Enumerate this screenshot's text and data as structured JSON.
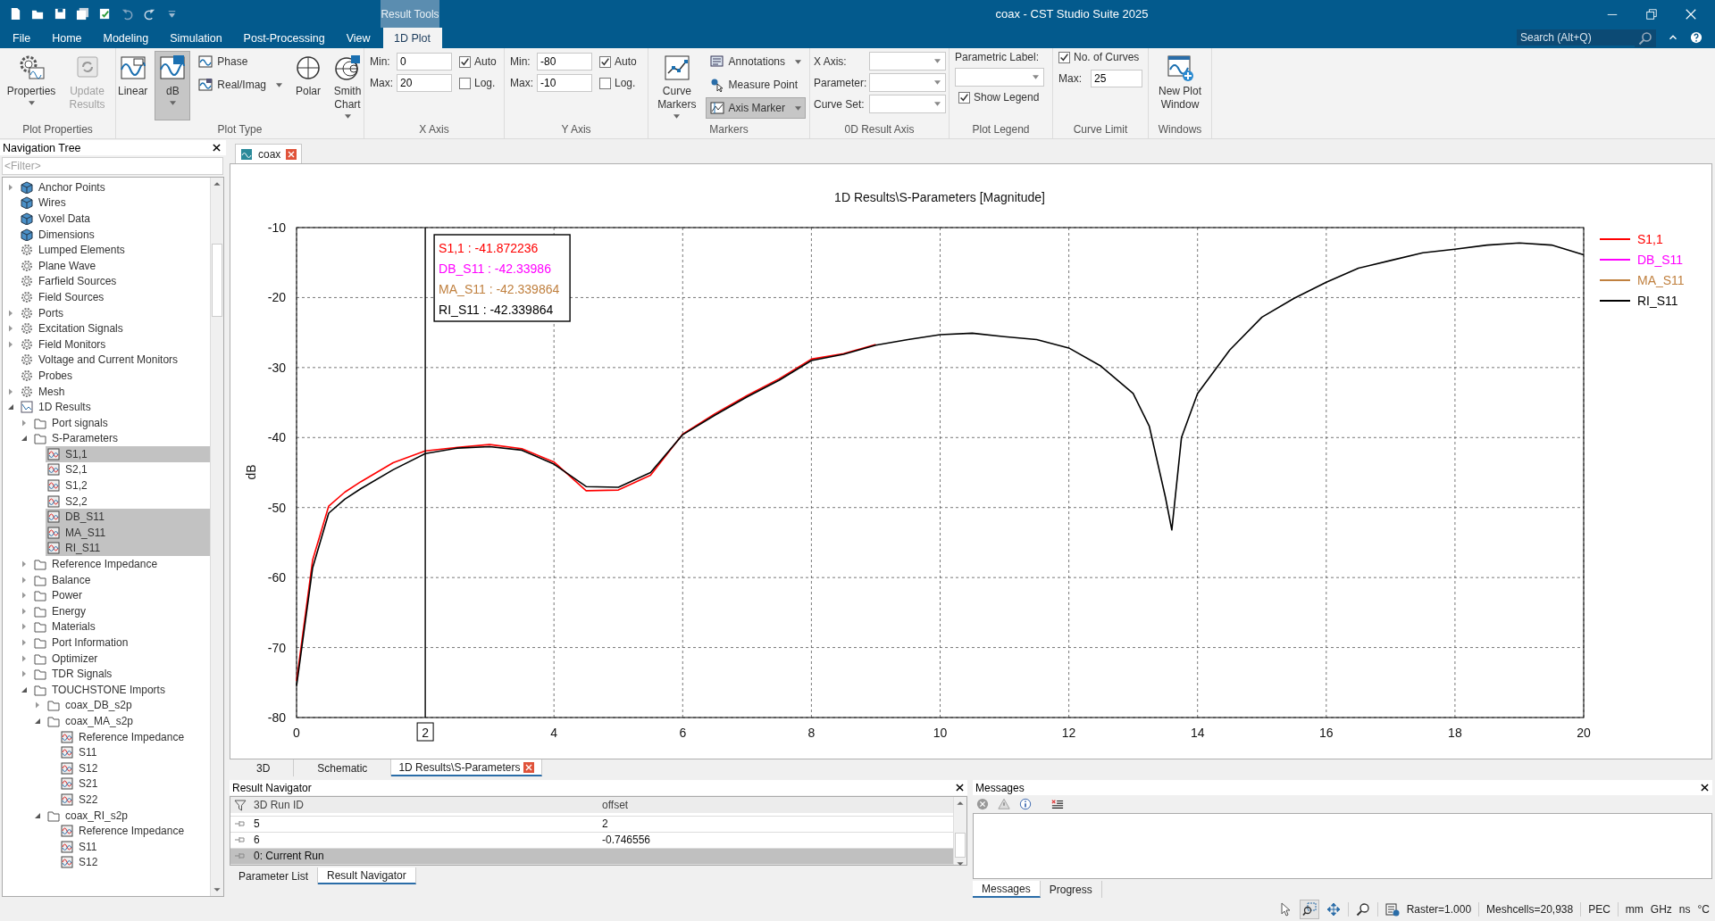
{
  "window": {
    "title": "coax - CST Studio Suite 2025",
    "context_group": "Result Tools"
  },
  "menu_tabs": [
    {
      "label": "File",
      "selected": false
    },
    {
      "label": "Home",
      "selected": false
    },
    {
      "label": "Modeling",
      "selected": false
    },
    {
      "label": "Simulation",
      "selected": false
    },
    {
      "label": "Post-Processing",
      "selected": false
    },
    {
      "label": "View",
      "selected": false
    },
    {
      "label": "1D Plot",
      "selected": true
    }
  ],
  "search": {
    "placeholder": "Search (Alt+Q)"
  },
  "ribbon": {
    "groups": [
      {
        "kind": "buttons",
        "label": "Plot Properties",
        "buttons": [
          {
            "label": "Properties",
            "kind": "large",
            "dropdown": true,
            "selected": false,
            "disabled": false
          },
          {
            "label": "Update Results",
            "kind": "large",
            "dropdown": false,
            "selected": false,
            "disabled": true
          }
        ]
      },
      {
        "kind": "buttons",
        "label": "Plot Type",
        "buttons": [
          {
            "label": "Linear",
            "kind": "large",
            "dropdown": false,
            "selected": false,
            "disabled": false
          },
          {
            "label": "dB",
            "kind": "large",
            "dropdown": true,
            "selected": true,
            "disabled": false
          },
          {
            "label": "Phase",
            "kind": "small",
            "dropdown": false,
            "selected": false,
            "disabled": false
          },
          {
            "label": "Real/Imag",
            "kind": "small",
            "dropdown": true,
            "selected": false,
            "disabled": false
          },
          {
            "label": "Polar",
            "kind": "large",
            "dropdown": false,
            "selected": false,
            "disabled": false
          },
          {
            "label": "Smith Chart",
            "kind": "large",
            "dropdown": true,
            "selected": false,
            "disabled": false
          }
        ]
      },
      {
        "kind": "axis",
        "label": "X Axis",
        "min_label": "Min:",
        "min": "0",
        "max_label": "Max:",
        "max": "20",
        "auto": {
          "label": "Auto",
          "checked": true
        },
        "log": {
          "label": "Log.",
          "checked": false
        }
      },
      {
        "kind": "axis",
        "label": "Y Axis",
        "min_label": "Min:",
        "min": "-80",
        "max_label": "Max:",
        "max": "-10",
        "auto": {
          "label": "Auto",
          "checked": true
        },
        "log": {
          "label": "Log.",
          "checked": false
        }
      },
      {
        "kind": "buttons",
        "label": "Markers",
        "buttons": [
          {
            "label": "Curve Markers",
            "kind": "large",
            "dropdown": true,
            "selected": false,
            "disabled": false
          },
          {
            "label": "Annotations",
            "kind": "small",
            "dropdown": true,
            "selected": false,
            "disabled": false
          },
          {
            "label": "Measure Point",
            "kind": "small",
            "dropdown": false,
            "selected": false,
            "disabled": false
          },
          {
            "label": "Axis Marker",
            "kind": "small",
            "dropdown": true,
            "selected": true,
            "disabled": false
          }
        ]
      },
      {
        "kind": "combos",
        "label": "0D Result Axis",
        "fields": [
          {
            "label": "X Axis:"
          },
          {
            "label": "Parameter:"
          },
          {
            "label": "Curve Set:"
          }
        ]
      },
      {
        "kind": "legend",
        "label": "Plot Legend",
        "parametric_label": "Parametric Label:",
        "show_legend": {
          "label": "Show Legend",
          "checked": true
        }
      },
      {
        "kind": "limit",
        "label": "Curve Limit",
        "no_of_curves": {
          "label": "No. of Curves",
          "checked": true
        },
        "max_label": "Max:",
        "max": "25"
      },
      {
        "kind": "buttons",
        "label": "Windows",
        "buttons": [
          {
            "label": "New Plot Window",
            "kind": "large",
            "dropdown": false,
            "selected": false,
            "disabled": false
          }
        ]
      }
    ]
  },
  "navigation_tree": {
    "title": "Navigation Tree",
    "filter_placeholder": "<Filter>",
    "items": [
      {
        "label": "Anchor Points",
        "kind": "block",
        "expanded": false,
        "selected": false
      },
      {
        "label": "Wires",
        "kind": "block",
        "selected": false
      },
      {
        "label": "Voxel Data",
        "kind": "block",
        "selected": false
      },
      {
        "label": "Dimensions",
        "kind": "block",
        "selected": false
      },
      {
        "label": "Lumped Elements",
        "kind": "gear",
        "selected": false
      },
      {
        "label": "Plane Wave",
        "kind": "gear",
        "selected": false
      },
      {
        "label": "Farfield Sources",
        "kind": "gear",
        "selected": false
      },
      {
        "label": "Field Sources",
        "kind": "gear",
        "selected": false
      },
      {
        "label": "Ports",
        "kind": "gear",
        "expanded": false,
        "selected": false
      },
      {
        "label": "Excitation Signals",
        "kind": "gear",
        "expanded": false,
        "selected": false
      },
      {
        "label": "Field Monitors",
        "kind": "gear",
        "expanded": false,
        "selected": false
      },
      {
        "label": "Voltage and Current Monitors",
        "kind": "gear",
        "selected": false
      },
      {
        "label": "Probes",
        "kind": "gear",
        "selected": false
      },
      {
        "label": "Mesh",
        "kind": "gear",
        "expanded": false,
        "selected": false
      },
      {
        "label": "1D Results",
        "kind": "results",
        "expanded": true,
        "selected": false,
        "children": [
          {
            "label": "Port signals",
            "kind": "folder",
            "expanded": false,
            "selected": false
          },
          {
            "label": "S-Parameters",
            "kind": "folder",
            "expanded": true,
            "selected": false,
            "children": [
              {
                "label": "S1,1",
                "kind": "curve",
                "selected": true
              },
              {
                "label": "S2,1",
                "kind": "curve",
                "selected": false
              },
              {
                "label": "S1,2",
                "kind": "curve",
                "selected": false
              },
              {
                "label": "S2,2",
                "kind": "curve",
                "selected": false
              },
              {
                "label": "DB_S11",
                "kind": "curve",
                "selected": true
              },
              {
                "label": "MA_S11",
                "kind": "curve",
                "selected": true
              },
              {
                "label": "RI_S11",
                "kind": "curve",
                "selected": true
              }
            ]
          },
          {
            "label": "Reference Impedance",
            "kind": "folder",
            "expanded": false,
            "selected": false
          },
          {
            "label": "Balance",
            "kind": "folder",
            "expanded": false,
            "selected": false
          },
          {
            "label": "Power",
            "kind": "folder",
            "expanded": false,
            "selected": false
          },
          {
            "label": "Energy",
            "kind": "folder",
            "expanded": false,
            "selected": false
          },
          {
            "label": "Materials",
            "kind": "folder",
            "expanded": false,
            "selected": false
          },
          {
            "label": "Port Information",
            "kind": "folder",
            "expanded": false,
            "selected": false
          },
          {
            "label": "Optimizer",
            "kind": "folder",
            "expanded": false,
            "selected": false
          },
          {
            "label": "TDR Signals",
            "kind": "folder",
            "expanded": false,
            "selected": false
          },
          {
            "label": "TOUCHSTONE Imports",
            "kind": "folder",
            "expanded": true,
            "selected": false,
            "children": [
              {
                "label": "coax_DB_s2p",
                "kind": "folder",
                "expanded": false,
                "selected": false
              },
              {
                "label": "coax_MA_s2p",
                "kind": "folder",
                "expanded": true,
                "selected": false,
                "children": [
                  {
                    "label": "Reference Impedance",
                    "kind": "curve",
                    "selected": false
                  },
                  {
                    "label": "S11",
                    "kind": "curve",
                    "selected": false
                  },
                  {
                    "label": "S12",
                    "kind": "curve",
                    "selected": false
                  },
                  {
                    "label": "S21",
                    "kind": "curve",
                    "selected": false
                  },
                  {
                    "label": "S22",
                    "kind": "curve",
                    "selected": false
                  }
                ]
              },
              {
                "label": "coax_RI_s2p",
                "kind": "folder",
                "expanded": true,
                "selected": false,
                "children": [
                  {
                    "label": "Reference Impedance",
                    "kind": "curve",
                    "selected": false
                  },
                  {
                    "label": "S11",
                    "kind": "curve",
                    "selected": false
                  },
                  {
                    "label": "S12",
                    "kind": "curve",
                    "selected": false
                  }
                ]
              }
            ]
          }
        ]
      }
    ]
  },
  "document_tabs": [
    {
      "label": "coax",
      "selected": true
    }
  ],
  "plot": {
    "chart_data": {
      "type": "line",
      "title": "1D Results\\S-Parameters [Magnitude]",
      "ylabel": "dB",
      "xlim": [
        0,
        20
      ],
      "ylim": [
        -80,
        -10
      ],
      "xticks": [
        0,
        4,
        6,
        8,
        10,
        12,
        14,
        16,
        18,
        20
      ],
      "yticks": [
        -80,
        -70,
        -60,
        -50,
        -40,
        -30,
        -20,
        -10
      ],
      "x": [
        0,
        0.25,
        0.5,
        0.75,
        1,
        1.5,
        2,
        2.5,
        3,
        3.5,
        4,
        4.5,
        5,
        5.5,
        6,
        6.5,
        7,
        7.5,
        8,
        8.5,
        9,
        9.5,
        10,
        10.5,
        11,
        11.5,
        12,
        12.5,
        13,
        13.25,
        13.5,
        13.6,
        13.75,
        14,
        14.5,
        15,
        15.5,
        16,
        16.5,
        17,
        17.5,
        18,
        18.5,
        19,
        19.5,
        20
      ],
      "series": [
        {
          "name": "S1,1",
          "color": "#ff0000",
          "values": [
            -74.8,
            -57.5,
            -49.8,
            -47.8,
            -46.3,
            -43.6,
            -41.9,
            -41.4,
            -41.0,
            -41.6,
            -43.5,
            -47.6,
            -47.5,
            -45.4,
            -39.5,
            -36.6,
            -34.0,
            -31.6,
            -28.8,
            -28.0,
            -26.7,
            null,
            null,
            null,
            null,
            null,
            null,
            null,
            null,
            null,
            null,
            null,
            null,
            null,
            null,
            null,
            null,
            null,
            null,
            null,
            null,
            null,
            null,
            null,
            null,
            null
          ]
        },
        {
          "name": "DB_S11",
          "color": "#ff00ff",
          "values": [
            null,
            null,
            null,
            null,
            null,
            null,
            null,
            null,
            null,
            null,
            null,
            null,
            null,
            null,
            null,
            null,
            null,
            null,
            null,
            null,
            null,
            null,
            null,
            null,
            null,
            null,
            null,
            null,
            null,
            null,
            null,
            null,
            null,
            null,
            null,
            null,
            null,
            null,
            null,
            null,
            null,
            null,
            null,
            null,
            null,
            null
          ]
        },
        {
          "name": "MA_S11",
          "color": "#c0803f",
          "values": [
            null,
            null,
            null,
            null,
            null,
            null,
            null,
            null,
            null,
            null,
            null,
            null,
            null,
            null,
            null,
            null,
            null,
            null,
            null,
            null,
            null,
            null,
            null,
            null,
            null,
            null,
            null,
            null,
            null,
            null,
            null,
            null,
            null,
            null,
            null,
            null,
            null,
            null,
            null,
            null,
            null,
            null,
            null,
            null,
            null,
            null
          ]
        },
        {
          "name": "RI_S11",
          "color": "#000000",
          "values": [
            -75.5,
            -58.6,
            -50.8,
            -48.8,
            -47.3,
            -44.6,
            -42.3,
            -41.5,
            -41.3,
            -41.8,
            -43.8,
            -47.0,
            -47.1,
            -45.0,
            -39.6,
            -36.8,
            -34.2,
            -31.8,
            -29.0,
            -28.1,
            -26.8,
            -26.0,
            -25.3,
            -25.1,
            -25.6,
            -26.0,
            -27.2,
            -29.8,
            -33.7,
            -38.4,
            -48.5,
            -53.2,
            -40.0,
            -33.7,
            -27.5,
            -22.8,
            -20.1,
            -17.8,
            -15.8,
            -14.7,
            -13.6,
            -13.1,
            -12.5,
            -12.2,
            -12.5,
            -13.9
          ]
        }
      ],
      "grid": true,
      "legend": true,
      "ref_lines": [
        {
          "axis": "x",
          "value": 2,
          "label": "2",
          "color": "#000000"
        }
      ]
    },
    "marker_readouts": [
      {
        "text": "S1,1 : -41.872236",
        "color": "#ff0000"
      },
      {
        "text": "DB_S11 : -42.33986",
        "color": "#ff00ff"
      },
      {
        "text": "MA_S11 : -42.339864",
        "color": "#c0803f"
      },
      {
        "text": "RI_S11 : -42.339864",
        "color": "#000000"
      }
    ]
  },
  "view_tabs": [
    {
      "label": "3D",
      "selected": false
    },
    {
      "label": "Schematic",
      "selected": false
    },
    {
      "label": "1D Results\\S-Parameters",
      "selected": true
    }
  ],
  "result_navigator": {
    "title": "Result Navigator",
    "columns": [
      "3D Run ID",
      "offset"
    ],
    "rows": [
      {
        "cells": [
          "5",
          "2"
        ],
        "selected": false
      },
      {
        "cells": [
          "6",
          "-0.746556"
        ],
        "selected": false
      },
      {
        "cells": [
          "0: Current Run"
        ],
        "selected": true
      }
    ],
    "tabs": [
      {
        "label": "Parameter List",
        "selected": false
      },
      {
        "label": "Result Navigator",
        "selected": true
      }
    ]
  },
  "messages": {
    "title": "Messages",
    "tabs": [
      {
        "label": "Messages",
        "selected": true
      },
      {
        "label": "Progress",
        "selected": false
      }
    ]
  },
  "status_bar": {
    "raster": "Raster=1.000",
    "meshcells": "Meshcells=20,938",
    "material": "PEC",
    "units": [
      "mm",
      "GHz",
      "ns",
      "°C"
    ]
  }
}
